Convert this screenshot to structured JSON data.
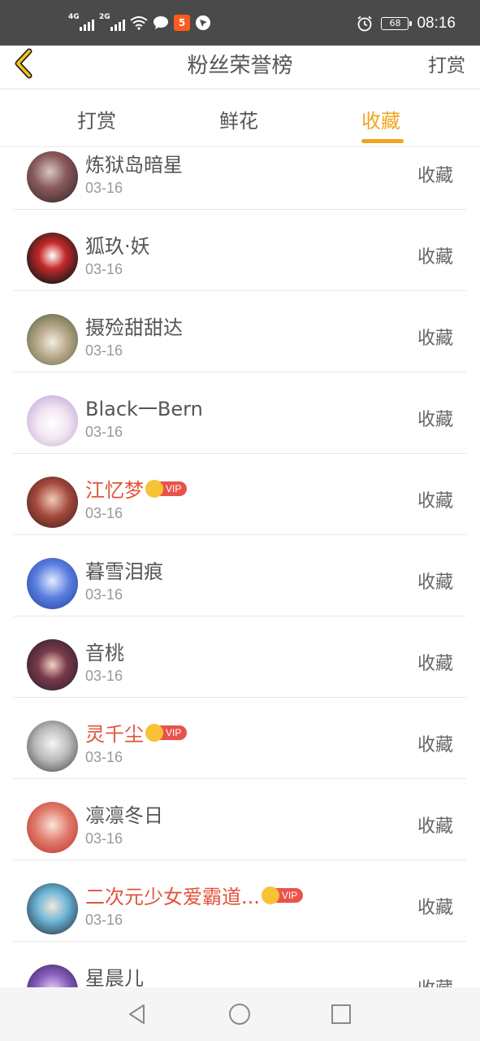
{
  "status_bar": {
    "signal1_label": "4G",
    "signal2_label": "2G",
    "app_badge": "5",
    "battery": "68",
    "time": "08:16"
  },
  "header": {
    "title": "粉丝荣誉榜",
    "right_action": "打赏",
    "back_icon": "chevron-left-icon"
  },
  "tabs": [
    {
      "label": "打赏",
      "active": false
    },
    {
      "label": "鲜花",
      "active": false
    },
    {
      "label": "收藏",
      "active": true
    }
  ],
  "accent_color": "#f0a51e",
  "vip_color": "#e2533b",
  "list": {
    "items": [
      {
        "name": "炼狱岛暗星",
        "date": "03-16",
        "action": "收藏",
        "vip": false,
        "vip_label": ""
      },
      {
        "name": "狐玖·妖",
        "date": "03-16",
        "action": "收藏",
        "vip": false,
        "vip_label": ""
      },
      {
        "name": "摄殓甜甜达",
        "date": "03-16",
        "action": "收藏",
        "vip": false,
        "vip_label": ""
      },
      {
        "name": "Black一Bern",
        "date": "03-16",
        "action": "收藏",
        "vip": false,
        "vip_label": ""
      },
      {
        "name": "江忆梦",
        "date": "03-16",
        "action": "收藏",
        "vip": true,
        "vip_label": "VIP"
      },
      {
        "name": "暮雪泪痕",
        "date": "03-16",
        "action": "收藏",
        "vip": false,
        "vip_label": ""
      },
      {
        "name": "音桃",
        "date": "03-16",
        "action": "收藏",
        "vip": false,
        "vip_label": ""
      },
      {
        "name": "灵千尘",
        "date": "03-16",
        "action": "收藏",
        "vip": true,
        "vip_label": "VIP"
      },
      {
        "name": "凛凛冬日",
        "date": "03-16",
        "action": "收藏",
        "vip": false,
        "vip_label": ""
      },
      {
        "name": "二次元少女爱霸道...",
        "date": "03-16",
        "action": "收藏",
        "vip": true,
        "vip_label": "VIP"
      },
      {
        "name": "星晨儿",
        "date": "",
        "action": "收藏",
        "vip": false,
        "vip_label": ""
      }
    ]
  },
  "system_nav": {
    "back_icon": "triangle-back-icon",
    "home_icon": "circle-home-icon",
    "recents_icon": "square-recents-icon"
  }
}
